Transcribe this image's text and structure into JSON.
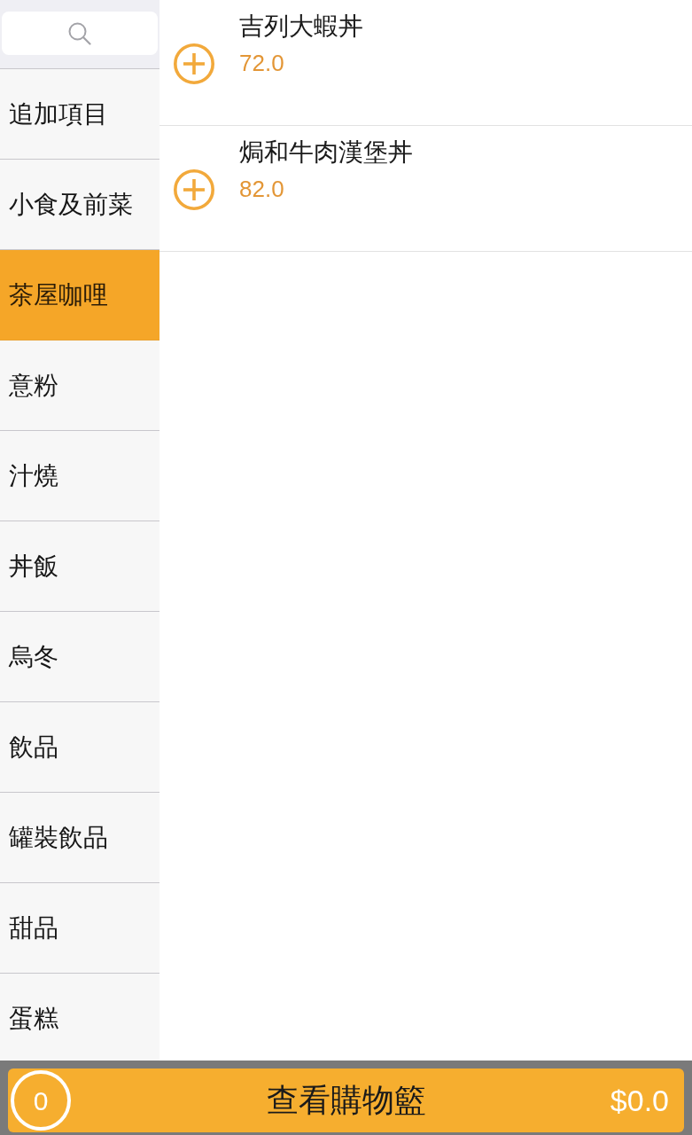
{
  "categories": [
    {
      "label": "追加項目",
      "selected": false
    },
    {
      "label": "小食及前菜",
      "selected": false
    },
    {
      "label": "茶屋咖哩",
      "selected": true
    },
    {
      "label": "意粉",
      "selected": false
    },
    {
      "label": "汁燒",
      "selected": false
    },
    {
      "label": "丼飯",
      "selected": false
    },
    {
      "label": "烏冬",
      "selected": false
    },
    {
      "label": "飲品",
      "selected": false
    },
    {
      "label": "罐裝飲品",
      "selected": false
    },
    {
      "label": "甜品",
      "selected": false
    },
    {
      "label": "蛋糕",
      "selected": false
    }
  ],
  "items": [
    {
      "name": "吉列大蝦丼",
      "price": "72.0"
    },
    {
      "name": "焗和牛肉漢堡丼",
      "price": "82.0"
    }
  ],
  "cart": {
    "count": "0",
    "label": "查看購物籃",
    "total": "$0.0"
  }
}
